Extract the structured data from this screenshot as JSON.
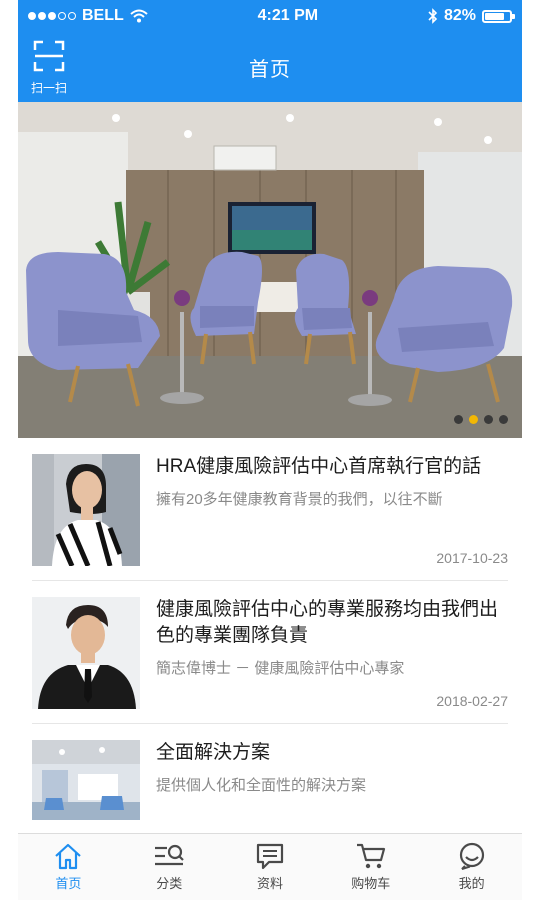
{
  "status_bar": {
    "carrier": "BELL",
    "time": "4:21 PM",
    "battery": "82%",
    "battery_level": 0.82
  },
  "header": {
    "title": "首页",
    "scan_label": "扫一扫"
  },
  "banner": {
    "page_count": 4,
    "active_index": 1
  },
  "news": [
    {
      "title": "HRA健康風險評估中心首席執行官的話",
      "subtitle": "擁有20多年健康教育背景的我們，以往不斷",
      "date": "2017-10-23"
    },
    {
      "title": "健康風險評估中心的專業服務均由我們出色的專業團隊負責",
      "subtitle": "簡志偉博士 － 健康風險評估中心專家",
      "date": "2018-02-27"
    },
    {
      "title": "全面解決方案",
      "subtitle": "提供個人化和全面性的解決方案"
    }
  ],
  "tabbar": {
    "items": [
      {
        "label": "首页",
        "icon": "home-icon",
        "active": true
      },
      {
        "label": "分类",
        "icon": "category-icon",
        "active": false
      },
      {
        "label": "资料",
        "icon": "document-icon",
        "active": false
      },
      {
        "label": "购物车",
        "icon": "cart-icon",
        "active": false
      },
      {
        "label": "我的",
        "icon": "profile-icon",
        "active": false
      }
    ]
  },
  "colors": {
    "brand": "#1e8ef0",
    "pager_active": "#f2b705"
  }
}
